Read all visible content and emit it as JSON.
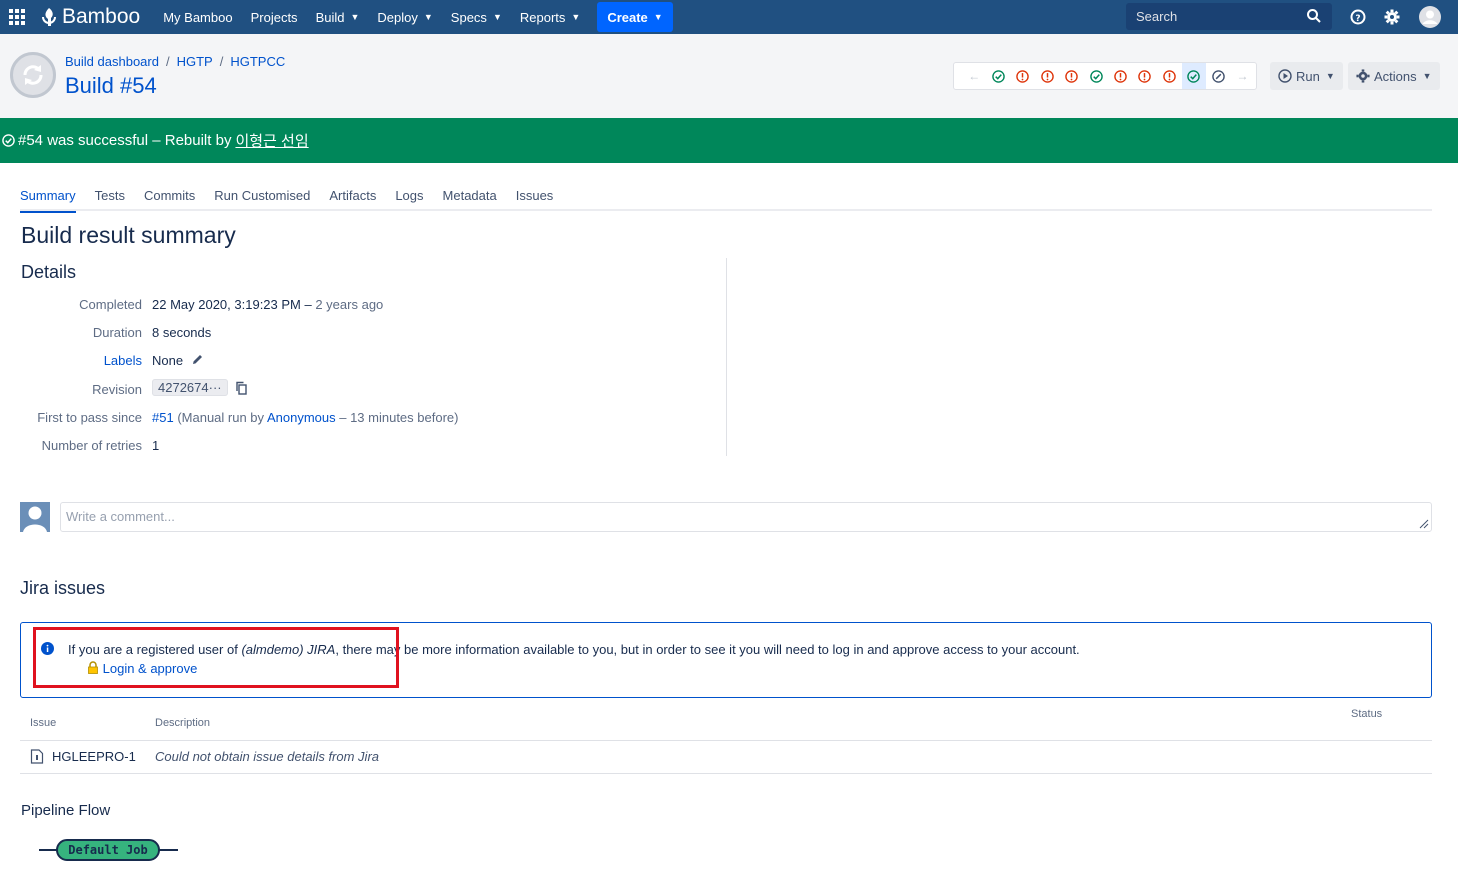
{
  "nav": {
    "logo": "Bamboo",
    "items": [
      "My Bamboo",
      "Projects",
      "Build",
      "Deploy",
      "Specs",
      "Reports"
    ],
    "create": "Create",
    "search_placeholder": "Search"
  },
  "header": {
    "breadcrumbs": [
      "Build dashboard",
      "HGTP",
      "HGTPCC"
    ],
    "title": "Build #54",
    "history": [
      "success",
      "failed",
      "failed",
      "failed",
      "success",
      "failed",
      "failed",
      "failed",
      "success",
      "unknown"
    ],
    "run_label": "Run",
    "actions_label": "Actions"
  },
  "banner": {
    "text": "#54 was successful – Rebuilt by",
    "user": "이형근 선임"
  },
  "tabs": [
    "Summary",
    "Tests",
    "Commits",
    "Run Customised",
    "Artifacts",
    "Logs",
    "Metadata",
    "Issues"
  ],
  "summary": {
    "title": "Build result summary",
    "details_title": "Details",
    "completed_label": "Completed",
    "completed_value": "22 May 2020, 3:19:23 PM",
    "completed_ago": "2 years ago",
    "duration_label": "Duration",
    "duration_value": "8 seconds",
    "labels_label": "Labels",
    "labels_value": "None",
    "revision_label": "Revision",
    "revision_value": "4272674···",
    "first_pass_label": "First to pass since",
    "first_pass_build": "#51",
    "first_pass_text1": "(Manual run by",
    "first_pass_user": "Anonymous",
    "first_pass_text2": "– 13 minutes before)",
    "retries_label": "Number of retries",
    "retries_value": "1"
  },
  "comment": {
    "placeholder": "Write a comment..."
  },
  "jira": {
    "title": "Jira issues",
    "info_prefix": "If you are a registered user of",
    "info_server": "(almdemo) JIRA",
    "info_suffix": ", there may be more information available to you, but in order to see it you will need to log in and approve access to your account.",
    "login": "Login & approve",
    "columns": {
      "issue": "Issue",
      "description": "Description",
      "status": "Status"
    },
    "rows": [
      {
        "issue": "HGLEEPRO-1",
        "description": "Could not obtain issue details from Jira"
      }
    ]
  },
  "pipeline": {
    "title": "Pipeline Flow",
    "job": "Default Job"
  },
  "colors": {
    "nav": "#205081",
    "success": "#00875a",
    "link": "#0052cc",
    "error": "#de350b"
  }
}
